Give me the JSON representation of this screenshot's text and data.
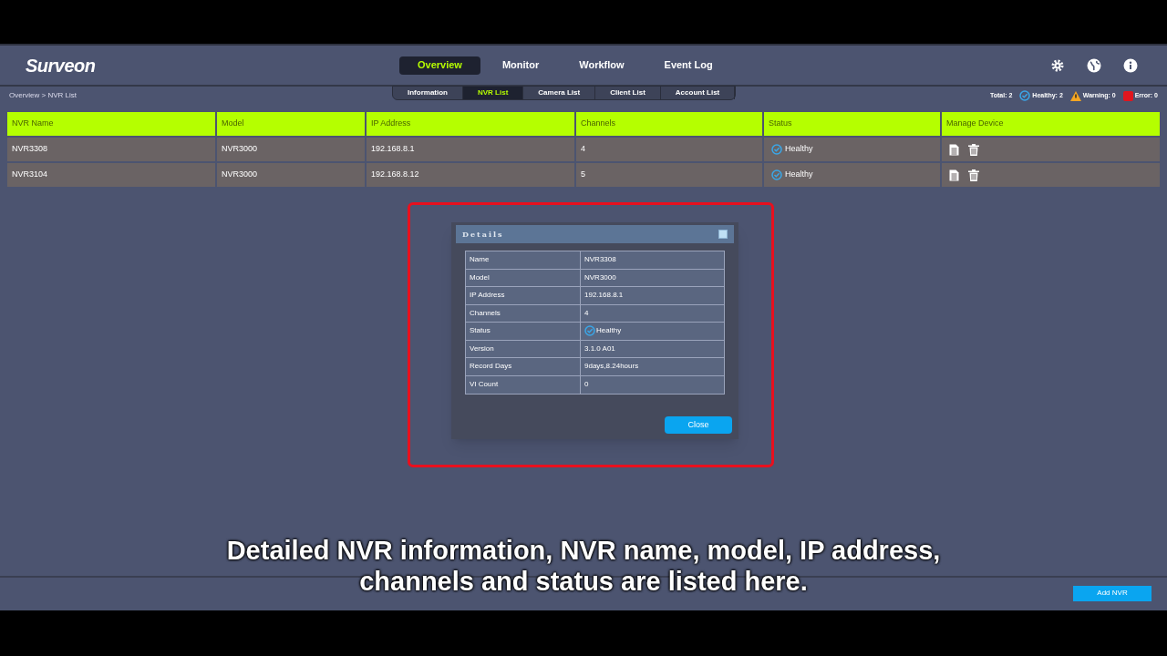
{
  "logo": "Surveon",
  "nav": [
    {
      "label": "Overview",
      "selected": true
    },
    {
      "label": "Monitor",
      "selected": false
    },
    {
      "label": "Workflow",
      "selected": false
    },
    {
      "label": "Event Log",
      "selected": false
    }
  ],
  "breadcrumb": "Overview > NVR List",
  "subtabs": [
    {
      "label": "Information",
      "selected": false
    },
    {
      "label": "NVR List",
      "selected": true
    },
    {
      "label": "Camera List",
      "selected": false
    },
    {
      "label": "Client List",
      "selected": false
    },
    {
      "label": "Account List",
      "selected": false
    }
  ],
  "summary": [
    {
      "kind": "total",
      "text": "Total: 2"
    },
    {
      "kind": "healthy",
      "text": "Healthy: 2"
    },
    {
      "kind": "warning",
      "text": "Warning: 0"
    },
    {
      "kind": "error",
      "text": "Error: 0"
    }
  ],
  "table": {
    "columns": [
      "NVR Name",
      "Model",
      "IP Address",
      "Channels",
      "Status",
      "Manage Device"
    ],
    "rows": [
      {
        "name": "NVR3308",
        "model": "NVR3000",
        "ip": "192.168.8.1",
        "channels": "4",
        "status": "Healthy"
      },
      {
        "name": "NVR3104",
        "model": "NVR3000",
        "ip": "192.168.8.12",
        "channels": "5",
        "status": "Healthy"
      }
    ]
  },
  "dialog": {
    "title": "Details",
    "rows": [
      {
        "label": "Name",
        "value": "NVR3308",
        "kind": "text"
      },
      {
        "label": "Model",
        "value": "NVR3000",
        "kind": "text"
      },
      {
        "label": "IP Address",
        "value": "192.168.8.1",
        "kind": "text"
      },
      {
        "label": "Channels",
        "value": "4",
        "kind": "text"
      },
      {
        "label": "Status",
        "value": "Healthy",
        "kind": "status"
      },
      {
        "label": "Version",
        "value": "3.1.0 A01",
        "kind": "text"
      },
      {
        "label": "Record Days",
        "value": "9days,8.24hours",
        "kind": "text"
      },
      {
        "label": "VI Count",
        "value": "0",
        "kind": "text"
      }
    ],
    "close_button": "Close"
  },
  "subtitle": [
    "Detailed NVR information, NVR name, model, IP address,",
    "channels and status are listed here."
  ],
  "add_button": "Add NVR"
}
